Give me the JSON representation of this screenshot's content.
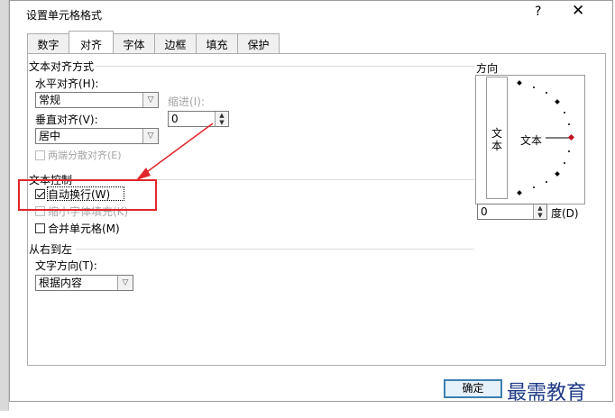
{
  "dialog": {
    "title": "设置单元格格式",
    "help": "?",
    "close": "✕"
  },
  "tabs": [
    {
      "label": "数字"
    },
    {
      "label": "对齐"
    },
    {
      "label": "字体"
    },
    {
      "label": "边框"
    },
    {
      "label": "填充"
    },
    {
      "label": "保护"
    }
  ],
  "text_alignment": {
    "group_label": "文本对齐方式",
    "horizontal_label": "水平对齐(H):",
    "horizontal_value": "常规",
    "indent_label": "缩进(I):",
    "indent_value": "0",
    "vertical_label": "垂直对齐(V):",
    "vertical_value": "居中",
    "justify_distributed_label": "两端分散对齐(E)"
  },
  "text_control": {
    "group_label": "文本控制",
    "wrap_text_label": "自动换行(W)",
    "wrap_text_checked": true,
    "shrink_to_fit_label": "缩小字体填充(K)",
    "merge_cells_label": "合并单元格(M)"
  },
  "rtl": {
    "group_label": "从右到左",
    "direction_label": "文字方向(T):",
    "direction_value": "根据内容"
  },
  "orientation": {
    "group_label": "方向",
    "vertical_text": "文本",
    "horizontal_text": "文本",
    "degree_value": "0",
    "degree_label": "度(D)"
  },
  "buttons": {
    "ok": "确定"
  },
  "watermark": "最需教育",
  "colors": {
    "highlight": "#e0262b",
    "arrow": "#e0262b",
    "watermark": "#1f3b87"
  }
}
